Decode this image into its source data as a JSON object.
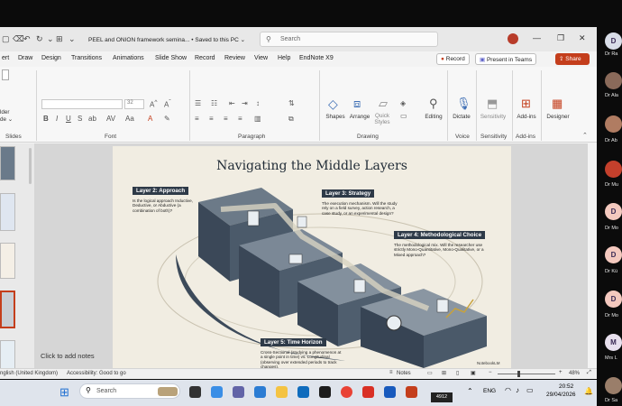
{
  "window": {
    "doc_title": "PEEL and ONION framework semina... • Saved to this PC ⌄",
    "search_placeholder": "Search"
  },
  "menu": {
    "items": [
      "ert",
      "Draw",
      "Design",
      "Transitions",
      "Animations",
      "Slide Show",
      "Record",
      "Review",
      "View",
      "Help",
      "EndNote X9"
    ],
    "record_label": "Record",
    "present_label": "Present in Teams",
    "share_label": "Share"
  },
  "ribbon": {
    "groups": [
      "Slides",
      "Font",
      "Paragraph",
      "Drawing",
      "Voice",
      "Sensitivity",
      "Add-ins"
    ],
    "left_stub": [
      "lder",
      "de ⌄"
    ],
    "font_size": "32",
    "buttons": [
      "Shapes",
      "Arrange",
      "Quick Styles",
      "Editing",
      "Dictate",
      "Sensitivity",
      "Add-ins",
      "Designer"
    ]
  },
  "slide": {
    "title": "Navigating the Middle Layers",
    "callouts": [
      {
        "header": "Layer 2: Approach",
        "body": "Is the logical approach Inductive, Deductive, or Abductive (a combination of both)?"
      },
      {
        "header": "Layer 3: Strategy",
        "body": "The execution mechanism. Will the study rely on a field survey, action research, a case study, or an experimental design?"
      },
      {
        "header": "Layer 4: Methodological Choice",
        "body": "The methodological mix. Will the researcher use strictly Mono-Quantitative, Mono-Qualitative, or a Mixed approach?"
      },
      {
        "header": "Layer 5: Time Horizon",
        "body": "Cross-Sectional (studying a phenomenon at a single point in time) vs. Longitudinal (observing over extended periods to track changes)."
      }
    ],
    "watermark": "NotebookLM"
  },
  "notes_placeholder": "Click to add notes",
  "status": {
    "language": "nglish (United Kingdom)",
    "accessibility": "Accessibility: Good to go",
    "notes": "Notes",
    "zoom": "48%"
  },
  "taskbar": {
    "search": "Search",
    "lang": "ENG",
    "time": "20:52",
    "date": "29/04/2026",
    "badge": "4912"
  },
  "participants": [
    {
      "initial": "D",
      "name": "Dr Ra",
      "color": "#d9dde8"
    },
    {
      "initial": "",
      "name": "Dr Ala",
      "color": "#8a6a5a"
    },
    {
      "initial": "",
      "name": "Dr Ab",
      "color": "#b07c62"
    },
    {
      "initial": "",
      "name": "Dr Mu",
      "color": "#c4402c"
    },
    {
      "initial": "D",
      "name": "Dr Mo",
      "color": "#f4c9bf"
    },
    {
      "initial": "D",
      "name": "Dr Kü",
      "color": "#f4c9bf"
    },
    {
      "initial": "D",
      "name": "Dr Mo",
      "color": "#f4c9bf"
    },
    {
      "initial": "M",
      "name": "Mrs L",
      "color": "#e8e0ee"
    },
    {
      "initial": "",
      "name": "Dr Sa",
      "color": "#9a7e6a"
    }
  ]
}
